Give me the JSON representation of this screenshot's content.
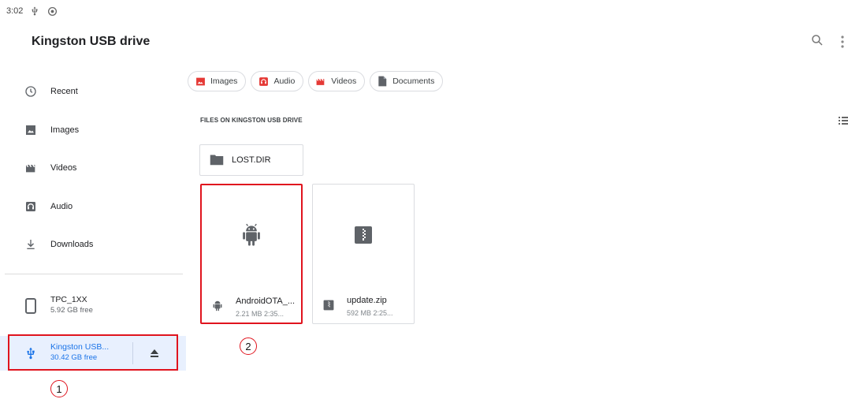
{
  "status_bar": {
    "time": "3:02",
    "icons": [
      "usb-icon",
      "sync-icon"
    ]
  },
  "header": {
    "title": "Kingston USB drive",
    "search_icon": "search-icon",
    "more_icon": "more-vert-icon"
  },
  "sidebar": {
    "items": [
      {
        "label": "Recent",
        "icon": "clock-icon"
      },
      {
        "label": "Images",
        "icon": "image-icon"
      },
      {
        "label": "Videos",
        "icon": "video-icon"
      },
      {
        "label": "Audio",
        "icon": "audio-icon"
      },
      {
        "label": "Downloads",
        "icon": "download-icon"
      }
    ],
    "roots": [
      {
        "title": "TPC_1XX",
        "subtitle": "5.92 GB free",
        "icon": "phone-icon"
      },
      {
        "title": "Kingston USB...",
        "subtitle": "30.42 GB free",
        "icon": "usb-icon",
        "active": true
      }
    ]
  },
  "chips": [
    {
      "label": "Images",
      "icon": "image-icon",
      "color": "#e53935"
    },
    {
      "label": "Audio",
      "icon": "audio-icon",
      "color": "#e53935"
    },
    {
      "label": "Videos",
      "icon": "video-icon",
      "color": "#e53935"
    },
    {
      "label": "Documents",
      "icon": "document-icon",
      "color": "#5f6368"
    }
  ],
  "section_header": "FILES ON KINGSTON USB DRIVE",
  "folders": [
    {
      "name": "LOST.DIR",
      "icon": "folder-icon"
    }
  ],
  "files": [
    {
      "name": "AndroidOTA_...",
      "meta": "2.21 MB 2:35...",
      "icon": "android-icon"
    },
    {
      "name": "update.zip",
      "meta": "592 MB 2:25...",
      "icon": "zip-icon"
    }
  ],
  "annotations": {
    "label1": "1",
    "label2": "2",
    "color": "#e0141e"
  },
  "colors": {
    "accent": "#1a73e8",
    "active_bg": "#e8f0fe",
    "icon_gray": "#5f6368"
  }
}
